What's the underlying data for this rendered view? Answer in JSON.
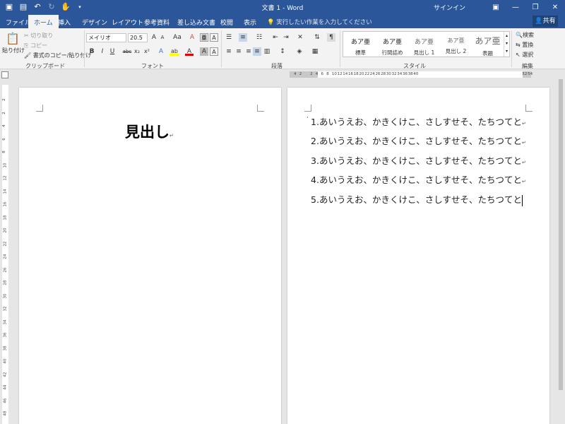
{
  "window": {
    "title": "文書 1  -  Word",
    "signin": "サインイン",
    "qat_icons": [
      "save-icon",
      "save-all-icon",
      "undo-icon",
      "redo-icon",
      "touch-mode-icon",
      "customize-qat-icon"
    ]
  },
  "tabs": [
    {
      "label": "ファイル"
    },
    {
      "label": "ホーム"
    },
    {
      "label": "挿入"
    },
    {
      "label": "デザイン"
    },
    {
      "label": "レイアウト"
    },
    {
      "label": "参考資料"
    },
    {
      "label": "差し込み文書"
    },
    {
      "label": "校閲"
    },
    {
      "label": "表示"
    }
  ],
  "tell_me": "実行したい作業を入力してください",
  "share_label": "共有",
  "ribbon": {
    "clipboard": {
      "paste": "貼り付け",
      "cut": "切り取り",
      "copy": "コピー",
      "format_painter": "書式のコピー/貼り付け",
      "group": "クリップボード"
    },
    "font": {
      "font_name": "メイリオ",
      "font_size": "20.5",
      "group": "フォント",
      "bold": "B",
      "italic": "I",
      "underline": "U",
      "strike": "abc",
      "subscript": "x₂",
      "superscript": "x²",
      "grow": "A",
      "shrink": "A",
      "case": "Aa",
      "clear": "A",
      "highlight": "ab",
      "color": "A",
      "shade": "A",
      "border": "A",
      "effects": "A"
    },
    "paragraph": {
      "group": "段落"
    },
    "styles": {
      "group": "スタイル",
      "items": [
        {
          "sample": "あア亜",
          "name": "標準"
        },
        {
          "sample": "あア亜",
          "name": "行間詰め"
        },
        {
          "sample": "あア亜",
          "name": "見出し 1"
        },
        {
          "sample": "あア亜",
          "name": "見出し 2"
        },
        {
          "sample": "あア亜",
          "name": "表題"
        }
      ]
    },
    "editing": {
      "group": "編集",
      "find": "検索",
      "replace": "置換",
      "select": "選択"
    }
  },
  "ruler": {
    "ticks": [
      "4",
      "2",
      "",
      "2",
      "4",
      "6",
      "8",
      "10",
      "12",
      "14",
      "16",
      "18",
      "20",
      "22",
      "24",
      "26",
      "28",
      "30",
      "32",
      "34",
      "36",
      "38",
      "40",
      "",
      "",
      "",
      "",
      "",
      "",
      "",
      "",
      "",
      "",
      "",
      "",
      "",
      "",
      "",
      "",
      "",
      "",
      "",
      "52",
      "54"
    ],
    "vticks": [
      "2",
      "2",
      "4",
      "6",
      "8",
      "10",
      "12",
      "14",
      "16",
      "18",
      "20",
      "22",
      "24",
      "26",
      "28",
      "30",
      "32",
      "34",
      "36",
      "38",
      "40",
      "42",
      "44",
      "46",
      "48"
    ]
  },
  "document": {
    "page1": {
      "heading": "見出し"
    },
    "page2": {
      "items": [
        {
          "num": "1.",
          "text": "あいうえお、かきくけこ、さしすせそ、たちつてと"
        },
        {
          "num": "2.",
          "text": "あいうえお、かきくけこ、さしすせそ、たちつてと"
        },
        {
          "num": "3.",
          "text": "あいうえお、かきくけこ、さしすせそ、たちつてと"
        },
        {
          "num": "4.",
          "text": "あいうえお、かきくけこ、さしすせそ、たちつてと"
        },
        {
          "num": "5.",
          "text": "あいうえお、かきくけこ、さしすせそ、たちつてと"
        }
      ]
    }
  },
  "colors": {
    "accent": "#2b579a",
    "ribbon": "#f3f3f3",
    "workspace": "#e6e6e6"
  }
}
